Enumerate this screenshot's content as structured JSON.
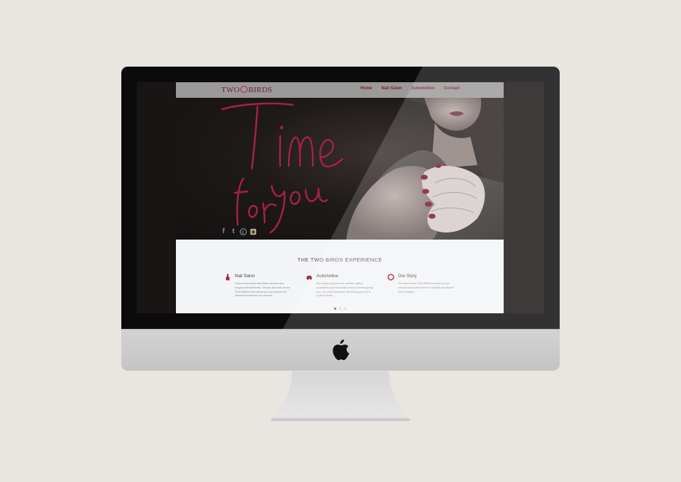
{
  "site": {
    "logo_text_left": "TWO",
    "logo_text_right": "BIRDS",
    "nav": [
      "Home",
      "Nail Salon",
      "Automotive",
      "Contact"
    ],
    "hero_script_line1": "Time",
    "hero_script_line2": "for",
    "hero_script_line3": "you",
    "social_icons": [
      "facebook-icon",
      "twitter-icon",
      "pinterest-icon",
      "instagram-icon"
    ],
    "section_title": "THE TWO BIRDS EXPERIENCE",
    "features": [
      {
        "icon": "nail-polish-icon",
        "title": "Nail Salon",
        "desc": "A full-service salon that offers luxurious and elegant nail treatments. Sit back and relax as the TWO BIRDS team will ensure you receive the pampered treatment you deserve."
      },
      {
        "icon": "car-icon",
        "title": "Automotive",
        "desc": "We employ only the best certified, skilled technicians and mechanics around, thereby giving you, our valued customer, the feeling your car is in good hands."
      },
      {
        "icon": "ring-icon",
        "title": "Our Story",
        "desc": "The idea behind TWO BIRDS is based on the concept that workers' time is valuable and should not be wasted."
      }
    ],
    "slider_dots": 3,
    "active_dot": 0
  },
  "colors": {
    "accent": "#a8214a",
    "background": "#e9e5df",
    "content_bg": "#f3f4f6"
  }
}
